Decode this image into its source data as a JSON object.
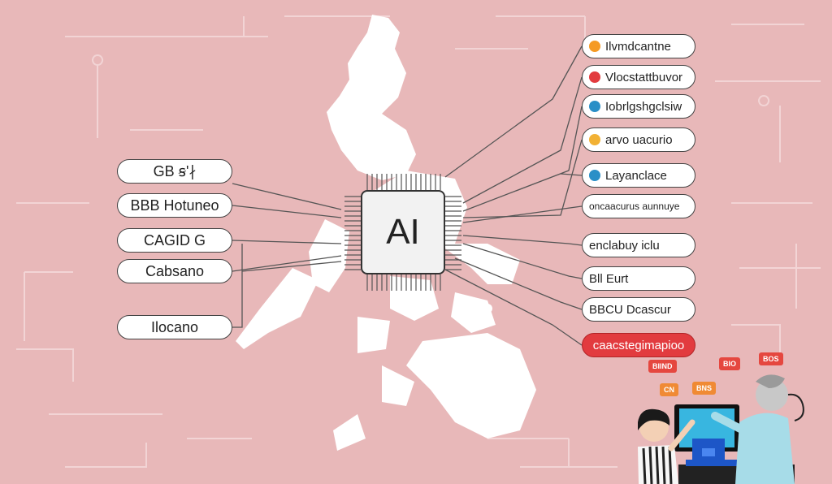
{
  "center": {
    "label": "AI"
  },
  "left_nodes": [
    {
      "label": "GB ꞩ'∤"
    },
    {
      "label": "BBB Hotuneo"
    },
    {
      "label": "CAGID G"
    },
    {
      "label": "Cabsano"
    },
    {
      "label": "Ilocano"
    }
  ],
  "right_nodes": [
    {
      "label": "Ilvmdcantne",
      "dot": "#f59a23"
    },
    {
      "label": "Vlocstattbuvor",
      "dot": "#e23b3f"
    },
    {
      "label": "Iobrlgshgclsiw",
      "dot": "#2a8fc7"
    },
    {
      "label": "arvo uacurio",
      "dot": "#f2b134"
    },
    {
      "label": "Layanclace",
      "dot": "#2a8fc7"
    },
    {
      "label": "oncaacurus aunnuye",
      "dot": ""
    },
    {
      "label": "enclabuy iclu",
      "dot": ""
    },
    {
      "label": "Bll  Eurt",
      "dot": ""
    },
    {
      "label": "BBCU  Dcascur",
      "dot": ""
    },
    {
      "label": "caacstegimapioo",
      "dot": ""
    }
  ],
  "bubbles": [
    {
      "label": "BIIND"
    },
    {
      "label": "BIO"
    },
    {
      "label": "BOS"
    },
    {
      "label": "CN"
    },
    {
      "label": "BNS"
    }
  ],
  "colors": {
    "background": "#e8b8b9",
    "map": "#ffffff",
    "accent_red": "#e23b3f",
    "accent_orange": "#f08a34",
    "accent_blue": "#2a8fc7"
  }
}
